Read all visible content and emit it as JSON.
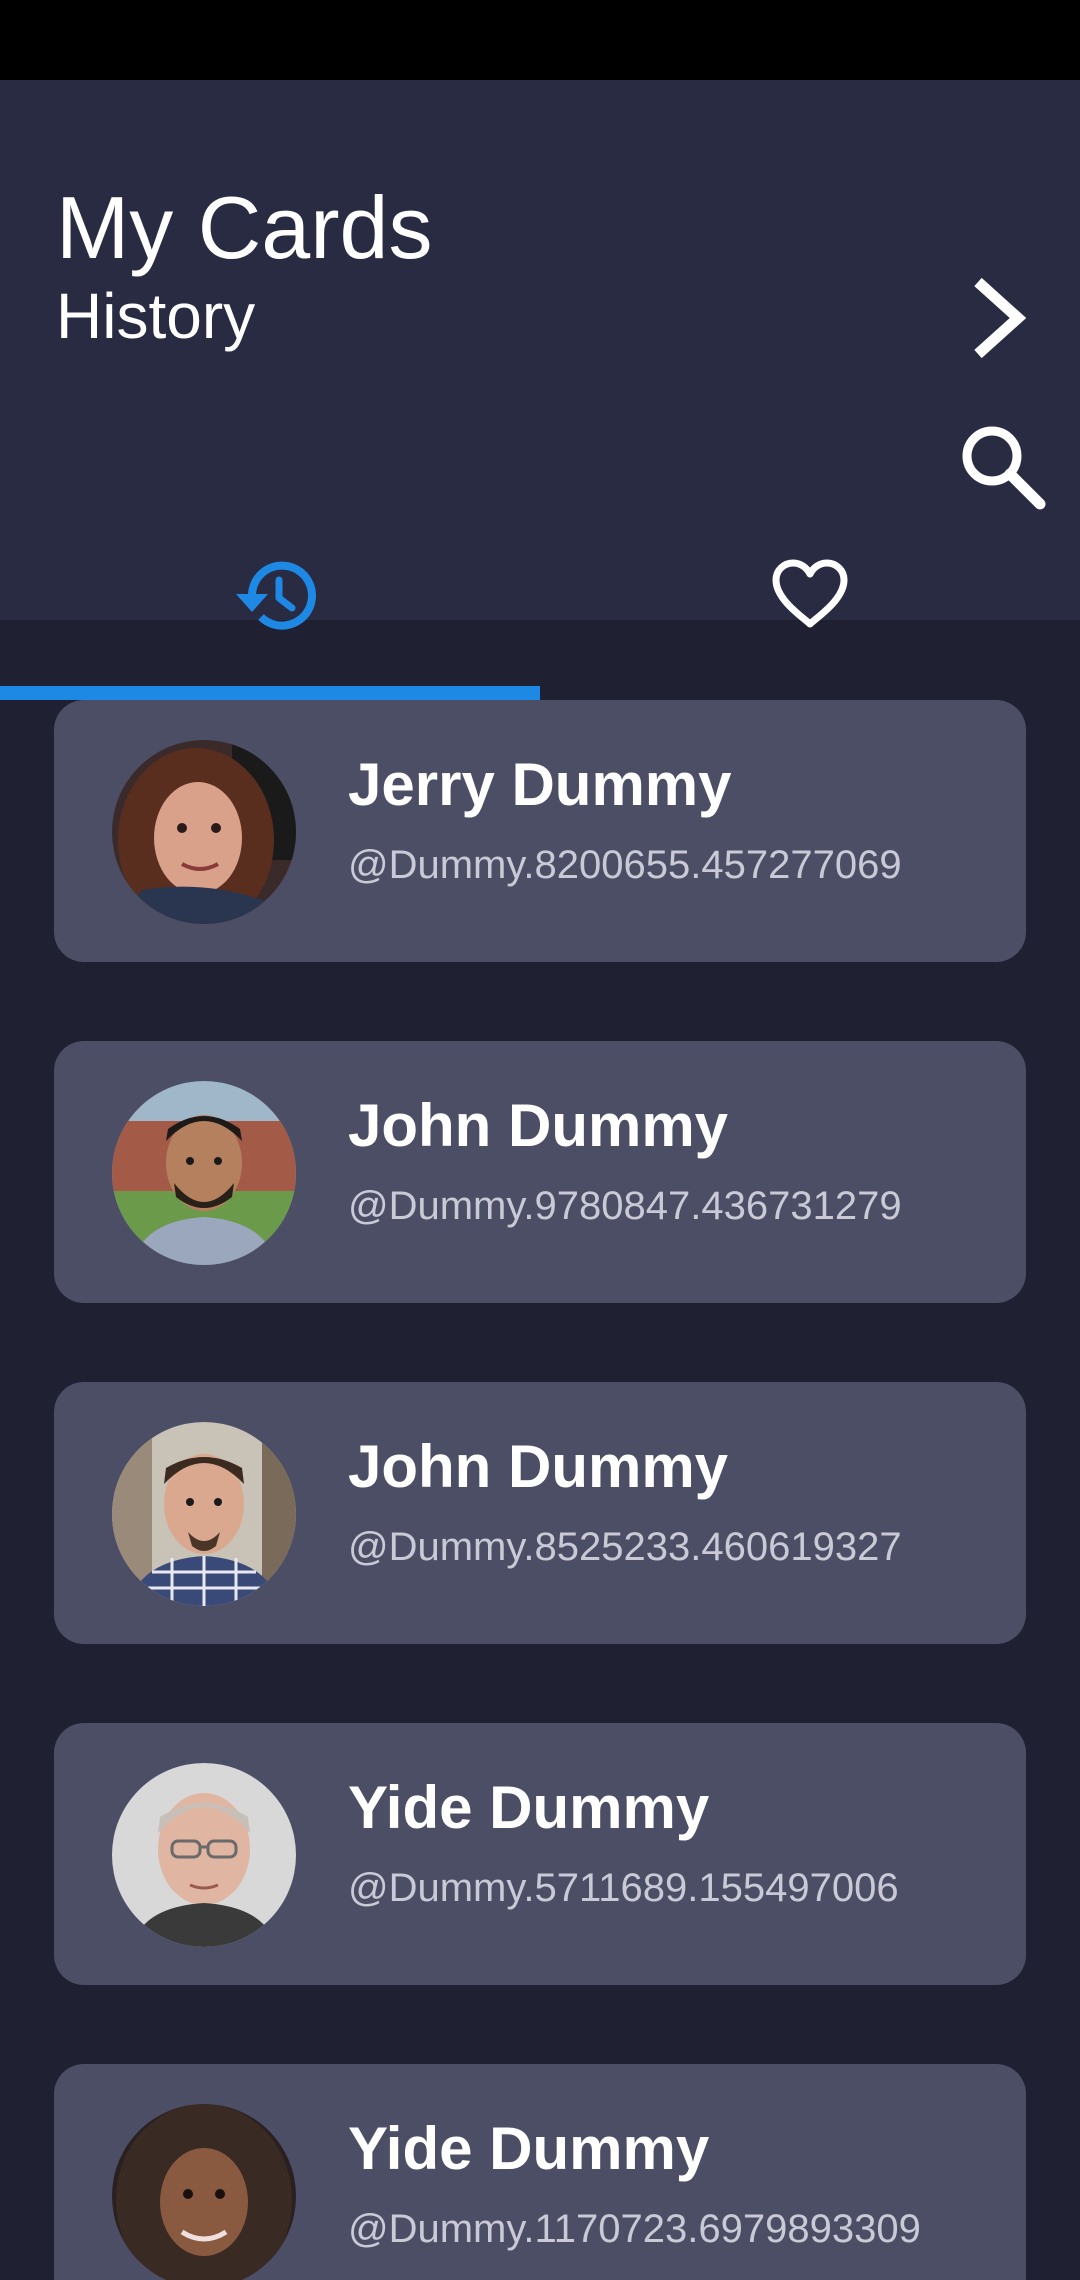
{
  "header": {
    "title": "My Cards",
    "subtitle": "History",
    "next_icon": "chevron-right-icon",
    "search_icon": "search-icon"
  },
  "tabs": [
    {
      "icon": "history-icon",
      "selected": true
    },
    {
      "icon": "heart-outline-icon",
      "selected": false
    }
  ],
  "colors": {
    "accent": "#1e88e5",
    "header_bg": "#292b42",
    "page_bg": "#1f2133",
    "card_bg": "#4c4e65"
  },
  "cards": [
    {
      "name": "Jerry Dummy",
      "handle": "@Dummy.8200655.457277069"
    },
    {
      "name": "John Dummy",
      "handle": "@Dummy.9780847.436731279"
    },
    {
      "name": "John Dummy",
      "handle": "@Dummy.8525233.460619327"
    },
    {
      "name": "Yide Dummy",
      "handle": "@Dummy.5711689.155497006"
    },
    {
      "name": "Yide Dummy",
      "handle": "@Dummy.1170723.6979893309"
    }
  ]
}
